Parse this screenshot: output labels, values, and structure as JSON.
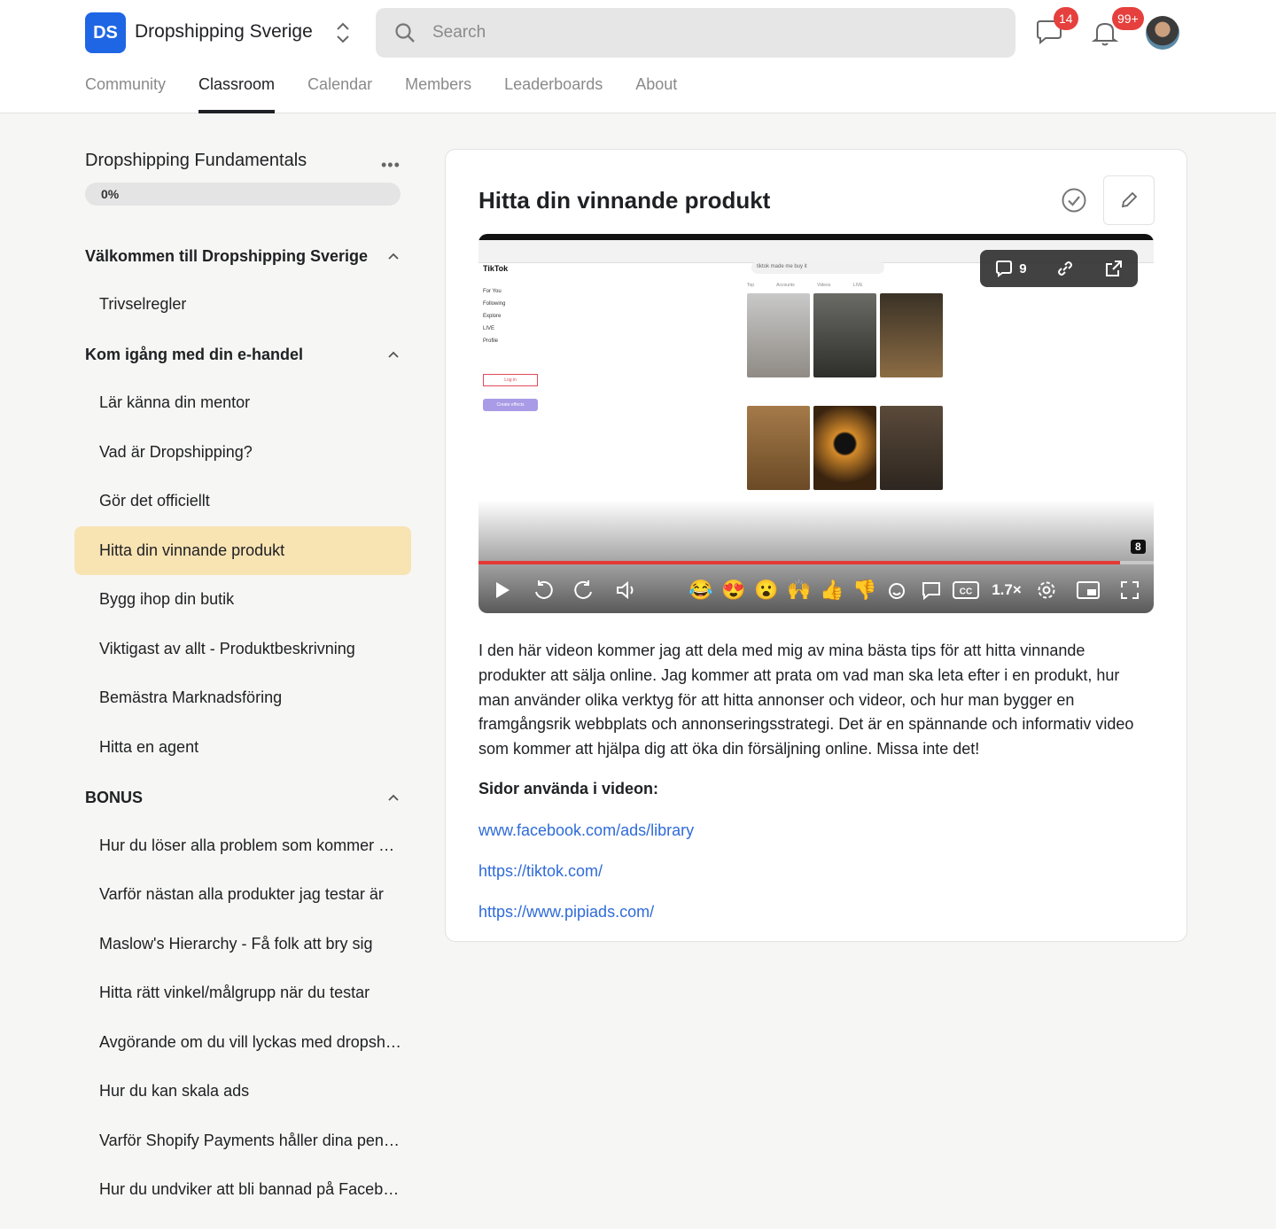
{
  "header": {
    "logo_initials": "DS",
    "group_name": "Dropshipping Sverige",
    "search_placeholder": "Search",
    "chat_badge": "14",
    "notifications_badge": "99+"
  },
  "nav": {
    "tabs": [
      {
        "label": "Community"
      },
      {
        "label": "Classroom"
      },
      {
        "label": "Calendar"
      },
      {
        "label": "Members"
      },
      {
        "label": "Leaderboards"
      },
      {
        "label": "About"
      }
    ],
    "active": "Classroom"
  },
  "sidebar": {
    "course_title": "Dropshipping Fundamentals",
    "menu_glyph": "•••",
    "progress": {
      "label": "0%",
      "value": 0
    },
    "sections": [
      {
        "title": "Välkommen till Dropshipping Sverige",
        "lessons": [
          "Trivselregler"
        ]
      },
      {
        "title": "Kom igång med din e-handel",
        "lessons": [
          "Lär känna din mentor",
          "Vad är Dropshipping?",
          "Gör det officiellt",
          "Hitta din vinnande produkt",
          "Bygg ihop din butik",
          "Viktigast av allt - Produktbeskrivning",
          "Bemästra Marknadsföring",
          "Hitta en agent"
        ]
      },
      {
        "title": "BONUS",
        "lessons": [
          "Hur du löser alla problem som kommer upp",
          "Varför nästan alla produkter jag testar är",
          "Maslow's Hierarchy - Få folk att bry sig",
          "Hitta rätt vinkel/målgrupp när du testar",
          "Avgörande om du vill lyckas med dropshipping",
          "Hur du kan skala ads",
          "Varför Shopify Payments håller dina pengar",
          "Hur du undviker att bli bannad på Facebook"
        ]
      }
    ],
    "active_lesson": "Hitta din vinnande produkt"
  },
  "lesson": {
    "title": "Hitta din vinnande produkt",
    "video": {
      "comment_count": "9",
      "progress": 0.95,
      "speed": "1.7×",
      "marker_count": "8",
      "screenshot": {
        "tiktok_logo": "TikTok",
        "search_text": "tiktok made me buy it",
        "nav": [
          "For You",
          "Following",
          "Explore",
          "LIVE",
          "Profile"
        ],
        "login": "Log in",
        "effects": "Create effects",
        "tabs": "Top Accounts Videos LIVE"
      }
    },
    "description": "I den här videon kommer jag att dela med mig av mina bästa tips för att hitta vinnande produkter att sälja online. Jag kommer att prata om vad man ska leta efter i en produkt, hur man använder olika verktyg för att hitta annonser och videor, och hur man bygger en framgångsrik webbplats och annonseringsstrategi. Det är en spännande och informativ video som kommer att hjälpa dig att öka din försäljning online. Missa inte det!",
    "pages_heading": "Sidor använda i videon:",
    "links": [
      "www.facebook.com/ads/library",
      "https://tiktok.com/",
      "https://www.pipiads.com/"
    ]
  },
  "colors": {
    "accent": "#1f66e5",
    "active_lesson_bg": "#f8e3b3",
    "badge": "#e5403d",
    "link": "#2f6bd8",
    "seek": "#e53935"
  }
}
